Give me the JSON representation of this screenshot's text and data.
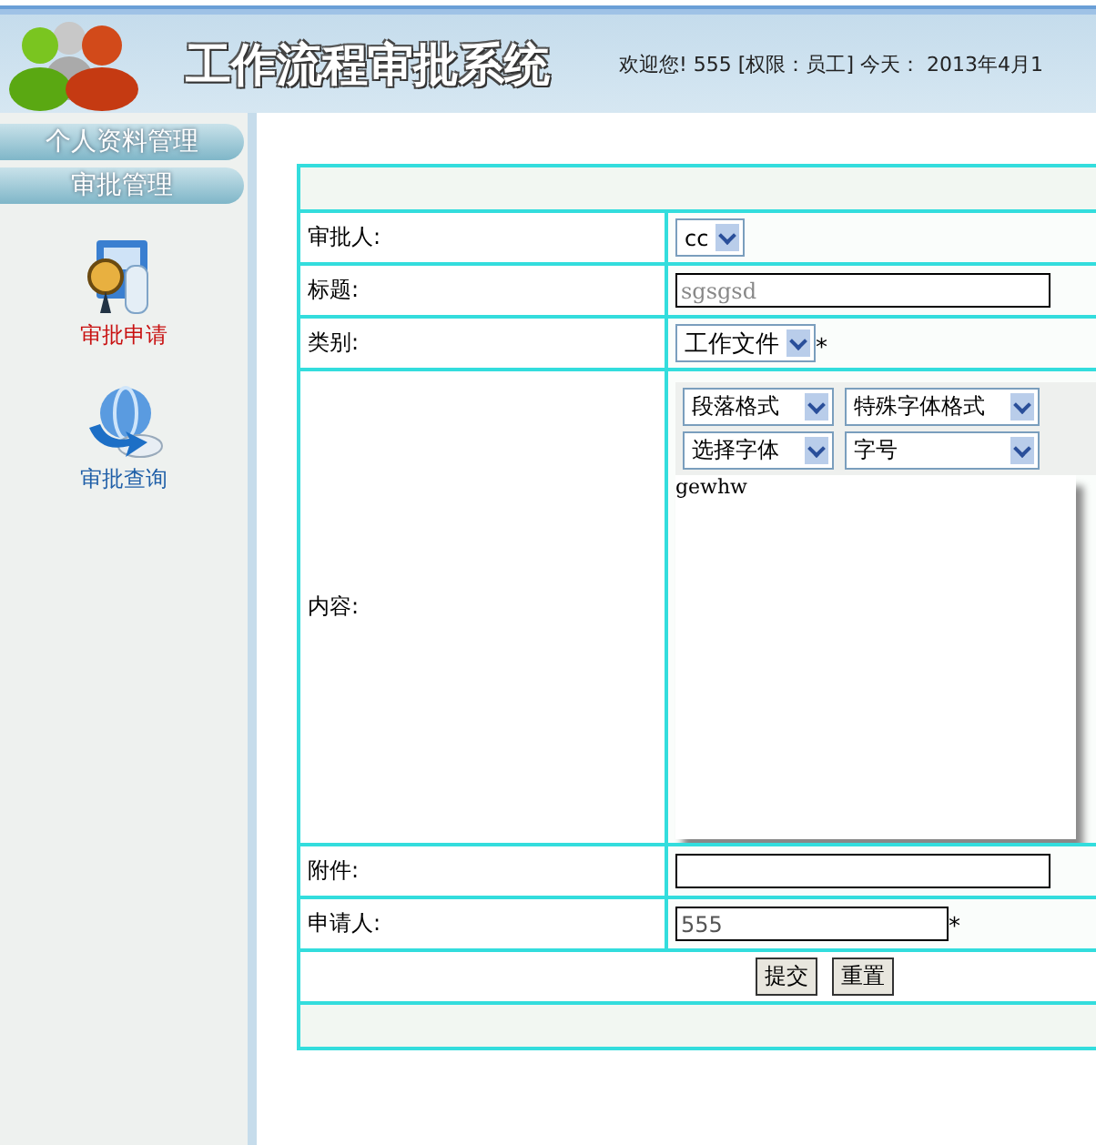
{
  "header": {
    "title": "工作流程审批系统",
    "welcome": "欢迎您! 555 [权限：员工] 今天： 2013年4月1"
  },
  "sidebar": {
    "menus": [
      "个人资料管理",
      "审批管理"
    ],
    "items": [
      {
        "label": "审批申请",
        "selected": true,
        "kind": "apply"
      },
      {
        "label": "审批查询",
        "selected": false,
        "kind": "query"
      }
    ]
  },
  "form": {
    "approver": {
      "label": "审批人:",
      "value": "cc"
    },
    "title": {
      "label": "标题:",
      "value": "sgsgsd"
    },
    "category": {
      "label": "类别:",
      "value": "工作文件",
      "required": "*"
    },
    "content": {
      "label": "内容:",
      "toolbar": [
        "段落格式",
        "特殊字体格式",
        "选择字体",
        "字号"
      ],
      "value": "gewhw"
    },
    "attachment": {
      "label": "附件:"
    },
    "applicant": {
      "label": "申请人:",
      "value": "555",
      "required": "*"
    },
    "buttons": [
      "提交",
      "重置"
    ]
  }
}
